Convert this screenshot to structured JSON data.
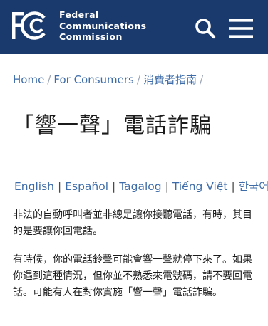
{
  "header": {
    "org_name_lines": [
      "Federal",
      "Communications",
      "Commission"
    ],
    "logo_icon": "fcc-logo-icon",
    "search_icon": "search-icon",
    "menu_icon": "hamburger-menu-icon",
    "colors": {
      "background": "#1a3a6e",
      "foreground": "#ffffff"
    }
  },
  "breadcrumb": {
    "items": [
      "Home",
      "For Consumers",
      "消費者指南"
    ],
    "separator": "/"
  },
  "page": {
    "title": "「響一聲」電話詐騙"
  },
  "languages": {
    "items": [
      "English",
      "Español",
      "Tagalog",
      "Tiếng Việt",
      "한국어"
    ],
    "separator": "|"
  },
  "content": {
    "paragraphs": [
      "非法的自動呼叫者並非總是讓你接聽電話，有時，其目的是要讓你回電話。",
      "有時候，你的電話鈴聲可能會響一聲就停下來了。如果你遇到這種情況，但你並不熟悉來電號碼，請不要回電話。可能有人在對你實施「響一聲」電話詐騙。"
    ]
  },
  "colors": {
    "link": "#3d6ca8",
    "text": "#1b1b1b",
    "muted": "#646e83"
  }
}
